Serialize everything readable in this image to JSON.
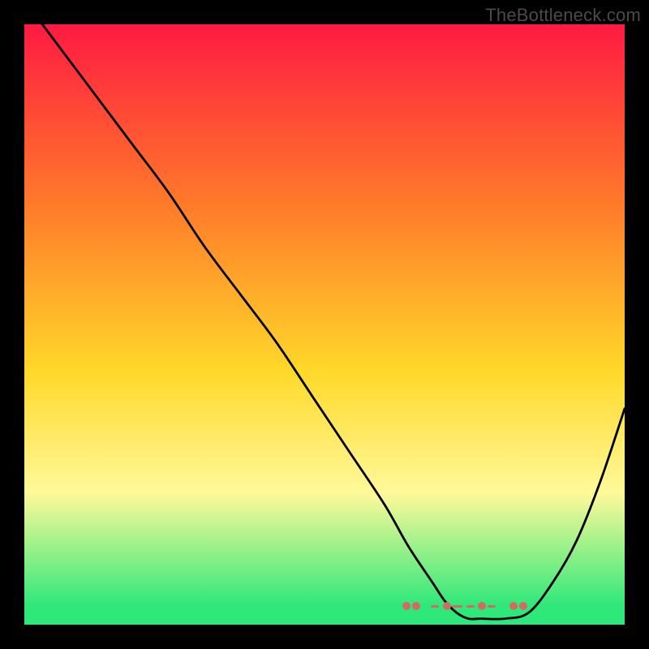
{
  "watermark": "TheBottleneck.com",
  "colors": {
    "gradient_top": "#ff1a42",
    "gradient_mid1": "#ff7a2a",
    "gradient_mid2": "#ffd92a",
    "gradient_mid3": "#fff99a",
    "gradient_bottom": "#2ee87a",
    "curve": "#000000",
    "markers": "#d36a64",
    "background": "#000000"
  },
  "chart_data": {
    "type": "line",
    "title": "",
    "xlabel": "",
    "ylabel": "",
    "xlim": [
      0,
      100
    ],
    "ylim": [
      0,
      100
    ],
    "series": [
      {
        "name": "curve",
        "x": [
          0,
          3,
          6,
          12,
          18,
          24,
          30,
          36,
          42,
          48,
          54,
          60,
          64,
          68,
          70,
          72,
          74,
          76,
          80,
          84,
          88,
          92,
          96,
          100
        ],
        "y": [
          104,
          100,
          96,
          88,
          80,
          72,
          63,
          55,
          47,
          38,
          29,
          20,
          13,
          7,
          4,
          2,
          1,
          1,
          1,
          2,
          7,
          14,
          24,
          36
        ]
      }
    ],
    "markers": {
      "name": "optimum-band",
      "x_start": 63,
      "x_end": 84,
      "y": 3
    },
    "background_gradient": {
      "stops": [
        {
          "offset": 0.0,
          "color": "#ff1a42"
        },
        {
          "offset": 0.3,
          "color": "#ff7a2a"
        },
        {
          "offset": 0.58,
          "color": "#ffd92a"
        },
        {
          "offset": 0.78,
          "color": "#fff99a"
        },
        {
          "offset": 0.97,
          "color": "#2ee87a"
        }
      ]
    }
  }
}
